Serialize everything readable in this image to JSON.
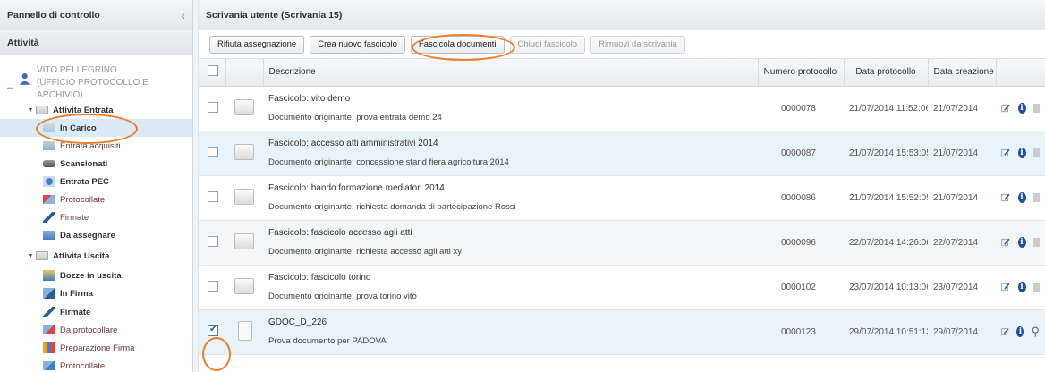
{
  "sidebar": {
    "title": "Pannello di controllo",
    "section": "Attività",
    "user": {
      "name": "VITO PELLEGRINO",
      "office": "(UFFICIO PROTOCOLLO E ARCHIVIO)"
    },
    "groups": [
      {
        "label": "Attivita Entrata",
        "items": [
          {
            "label": "In Carico",
            "bold": true,
            "selected": true
          },
          {
            "label": "Entrata acquisiti",
            "bold": false
          },
          {
            "label": "Scansionati",
            "bold": true
          },
          {
            "label": "Entrata PEC",
            "bold": true
          },
          {
            "label": "Protocollate",
            "bold": false
          },
          {
            "label": "Firmate",
            "bold": false
          },
          {
            "label": "Da assegnare",
            "bold": true
          }
        ]
      },
      {
        "label": "Attivita Uscita",
        "items": [
          {
            "label": "Bozze in uscita",
            "bold": true
          },
          {
            "label": "In Firma",
            "bold": true
          },
          {
            "label": "Firmate",
            "bold": true
          },
          {
            "label": "Da protocollare",
            "bold": false
          },
          {
            "label": "Preparazione Firma",
            "bold": false
          },
          {
            "label": "Protocollate",
            "bold": false
          }
        ]
      }
    ]
  },
  "main": {
    "title": "Scrivania utente (Scrivania 15)",
    "toolbar": {
      "rifiuta": "Rifiuta assegnazione",
      "crea": "Crea nuovo fascicolo",
      "fascicola": "Fascicola documenti",
      "chiudi": "Chiudi fascicolo",
      "rimuovi": "Rimuovi da scrivania"
    },
    "columns": {
      "descrizione": "Descrizione",
      "numero": "Numero protocollo",
      "data_protocollo": "Data protocollo",
      "data_creazione": "Data creazione"
    },
    "rows": [
      {
        "title": "Fascicolo: vito demo",
        "sub": "Documento originante: prova entrata demo 24",
        "numero": "0000078",
        "data_protocollo": "21/07/2014 11:52:06",
        "data_creazione": "21/07/2014"
      },
      {
        "title": "Fascicolo: accesso atti amministrativi 2014",
        "sub": "Documento originante: concessione stand fiera agricoltura 2014",
        "numero": "0000087",
        "data_protocollo": "21/07/2014 15:53:05",
        "data_creazione": "21/07/2014"
      },
      {
        "title": "Fascicolo: bando formazione mediatori 2014",
        "sub": "Documento originante: richiesta domanda di partecipazione Rossi",
        "numero": "0000086",
        "data_protocollo": "21/07/2014 15:52:05",
        "data_creazione": "21/07/2014"
      },
      {
        "title": "Fascicolo: fascicolo accesso agli atti",
        "sub": "Documento originante: richiesta accesso agli atti xy",
        "numero": "0000096",
        "data_protocollo": "22/07/2014 14:26:06",
        "data_creazione": "22/07/2014"
      },
      {
        "title": "Fascicolo: fascicolo torino",
        "sub": "Documento originante: prova torino vito",
        "numero": "0000102",
        "data_protocollo": "23/07/2014 10:13:06",
        "data_creazione": "23/07/2014"
      },
      {
        "title": "GDOC_D_226",
        "sub": "Prova documento per PADOVA",
        "numero": "0000123",
        "data_protocollo": "29/07/2014 10:51:13",
        "data_creazione": "29/07/2014"
      }
    ]
  },
  "colors": {
    "highlight": "#ef7d2a",
    "selected_row": "#dbeaf7",
    "alt_row": "#e9f3fb"
  }
}
